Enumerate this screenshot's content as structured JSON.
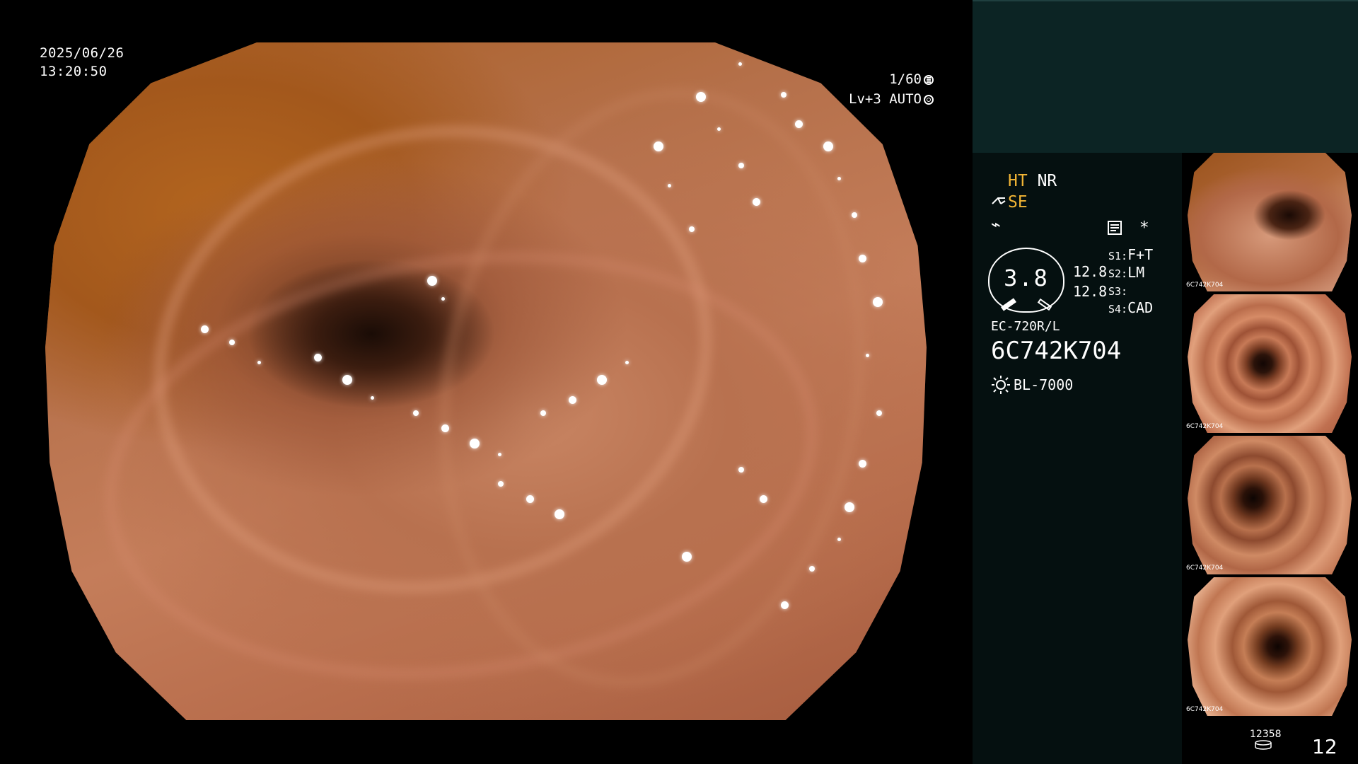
{
  "main_view": {
    "date": "2025/06/26",
    "time": "13:20:50",
    "shutter": "1/60",
    "enhancement": "Lv+3 AUTO",
    "icons": [
      "shutter-icon",
      "iris-icon"
    ]
  },
  "status": {
    "ht": "HT",
    "nr": "NR",
    "se": "SE",
    "freeze_symbol": "⌁",
    "asterisk": "*",
    "gauge_value": "3.8",
    "gauge_side_1": "12.8",
    "gauge_side_2": "12.8",
    "s1_label": "S1:",
    "s1_value": "F+T",
    "s2_label": "S2:",
    "s2_value": "LM",
    "s3_label": "S3:",
    "s3_value": "",
    "s4_label": "S4:",
    "s4_value": "CAD",
    "scope_model": "EC-720R/L",
    "scope_serial": "6C742K704",
    "light_source": "BL-7000",
    "colors": {
      "highlight": "#f2b535",
      "text": "#ffffff",
      "panel_top": "#0c2424"
    }
  },
  "thumbnails": [
    {
      "caption": "6C742K704"
    },
    {
      "caption": "6C742K704"
    },
    {
      "caption": "6C742K704"
    },
    {
      "caption": "6C742K704"
    }
  ],
  "footer": {
    "storage_count": "12358",
    "image_count": "12"
  }
}
